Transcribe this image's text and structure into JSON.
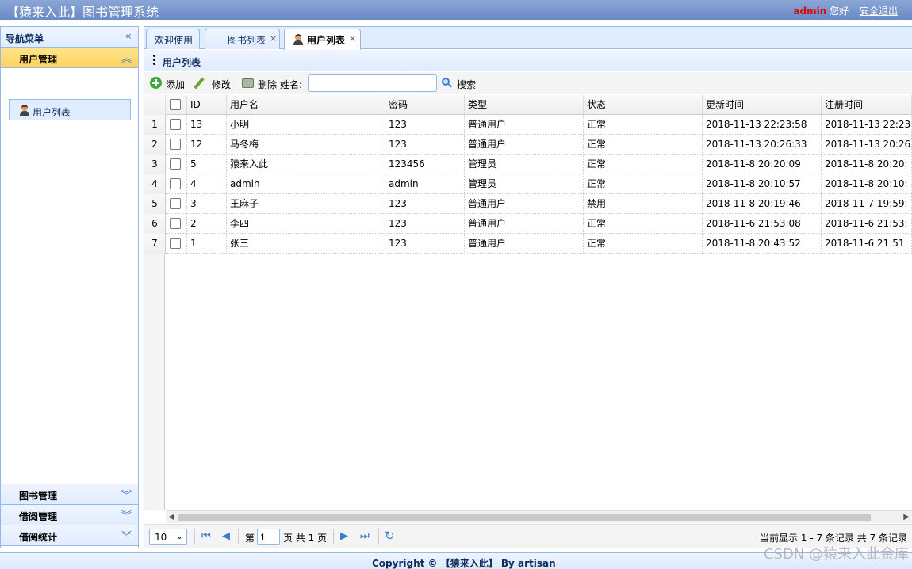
{
  "header": {
    "title": "【猿来入此】图书管理系统",
    "admin": "admin",
    "hello": "您好",
    "logout": "安全退出"
  },
  "nav": {
    "title": "导航菜单",
    "sections": [
      {
        "label": "用户管理",
        "active": true,
        "items": [
          {
            "label": "用户列表",
            "icon": "user-icon"
          }
        ]
      },
      {
        "label": "图书管理"
      },
      {
        "label": "借阅管理"
      },
      {
        "label": "借阅统计"
      }
    ]
  },
  "tabs": [
    {
      "label": "欢迎使用",
      "closable": false
    },
    {
      "label": "图书列表",
      "closable": true
    },
    {
      "label": "用户列表",
      "closable": true,
      "selected": true
    }
  ],
  "panel": {
    "title": "用户列表"
  },
  "toolbar": {
    "add": "添加",
    "edit": "修改",
    "delete": "删除",
    "name_label": "姓名:",
    "name_value": "",
    "search": "搜索"
  },
  "table": {
    "columns": [
      "ID",
      "用户名",
      "密码",
      "类型",
      "状态",
      "更新时间",
      "注册时间"
    ],
    "rows": [
      {
        "n": "1",
        "id": "13",
        "name": "小明",
        "pwd": "123",
        "type": "普通用户",
        "status": "正常",
        "updated": "2018-11-13 22:23:58",
        "registered": "2018-11-13 22:23"
      },
      {
        "n": "2",
        "id": "12",
        "name": "马冬梅",
        "pwd": "123",
        "type": "普通用户",
        "status": "正常",
        "updated": "2018-11-13 20:26:33",
        "registered": "2018-11-13 20:26"
      },
      {
        "n": "3",
        "id": "5",
        "name": "猿来入此",
        "pwd": "123456",
        "type": "管理员",
        "status": "正常",
        "updated": "2018-11-8 20:20:09",
        "registered": "2018-11-8 20:20:"
      },
      {
        "n": "4",
        "id": "4",
        "name": "admin",
        "pwd": "admin",
        "type": "管理员",
        "status": "正常",
        "updated": "2018-11-8 20:10:57",
        "registered": "2018-11-8 20:10:"
      },
      {
        "n": "5",
        "id": "3",
        "name": "王麻子",
        "pwd": "123",
        "type": "普通用户",
        "status": "禁用",
        "updated": "2018-11-8 20:19:46",
        "registered": "2018-11-7 19:59:"
      },
      {
        "n": "6",
        "id": "2",
        "name": "李四",
        "pwd": "123",
        "type": "普通用户",
        "status": "正常",
        "updated": "2018-11-6 21:53:08",
        "registered": "2018-11-6 21:53:"
      },
      {
        "n": "7",
        "id": "1",
        "name": "张三",
        "pwd": "123",
        "type": "普通用户",
        "status": "正常",
        "updated": "2018-11-8 20:43:52",
        "registered": "2018-11-6 21:51:"
      }
    ]
  },
  "pager": {
    "page_size": "10",
    "page_prefix": "第",
    "page_value": "1",
    "page_suffix": "页 共 1 页",
    "info": "当前显示 1 - 7 条记录 共 7 条记录"
  },
  "footer": {
    "text": "Copyright © 【猿来入此】 By artisan"
  },
  "watermark": "CSDN @猿来入此金库"
}
